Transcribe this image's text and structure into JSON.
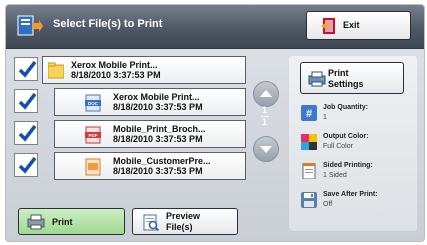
{
  "header": {
    "title": "Select File(s) to Print",
    "exit_label": "Exit"
  },
  "files": [
    {
      "name": "Xerox Mobile Print...",
      "date": "8/18/2010 3:37:53 PM",
      "checked": true,
      "type": "folder",
      "icon_label": ""
    },
    {
      "name": "Xerox Mobile Print...",
      "date": "8/18/2010 3:37:53 PM",
      "checked": true,
      "type": "doc",
      "icon_label": "DOC"
    },
    {
      "name": "Mobile_Print_Broch...",
      "date": "8/18/2010 3:37:53 PM",
      "checked": true,
      "type": "pdf",
      "icon_label": "PDF"
    },
    {
      "name": "Mobile_CustomerPre...",
      "date": "8/18/2010 3:37:53 PM",
      "checked": true,
      "type": "ppt",
      "icon_label": ""
    }
  ],
  "pager": {
    "current": "1",
    "total": "1"
  },
  "print_settings": {
    "button_line1": "Print",
    "button_line2": "Settings",
    "items": [
      {
        "label": "Job Quantity:",
        "value": "1",
        "icon": "hash-icon"
      },
      {
        "label": "Output Color:",
        "value": "Full Color",
        "icon": "color-palette-icon"
      },
      {
        "label": "Sided Printing:",
        "value": "1 Sided",
        "icon": "page-sides-icon"
      },
      {
        "label": "Save After Print:",
        "value": "Off",
        "icon": "save-disk-icon"
      }
    ]
  },
  "actions": {
    "print_label": "Print",
    "preview_line1": "Preview",
    "preview_line2": "File(s)"
  },
  "colors": {
    "header_dark": "#3e4751",
    "print_button": "#9fd98f",
    "check_blue": "#1a4fa8"
  }
}
